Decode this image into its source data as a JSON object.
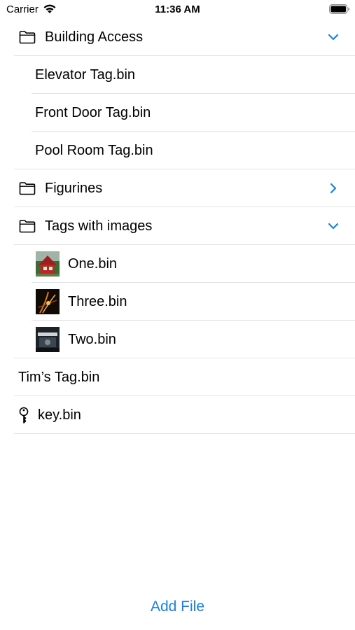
{
  "status_bar": {
    "carrier": "Carrier",
    "time": "11:36 AM"
  },
  "list": {
    "folder_building": {
      "label": "Building Access",
      "expanded": true,
      "children": [
        "Elevator Tag.bin",
        "Front Door Tag.bin",
        "Pool Room Tag.bin"
      ]
    },
    "folder_figurines": {
      "label": "Figurines",
      "expanded": false
    },
    "folder_tags_images": {
      "label": "Tags with images",
      "expanded": true,
      "children": [
        "One.bin",
        "Three.bin",
        "Two.bin"
      ]
    },
    "tim_tag": "Tim’s Tag.bin",
    "key_file": "key.bin"
  },
  "add_file_label": "Add File",
  "colors": {
    "accent": "#1a82e0",
    "separator": "#e2e2e6"
  }
}
